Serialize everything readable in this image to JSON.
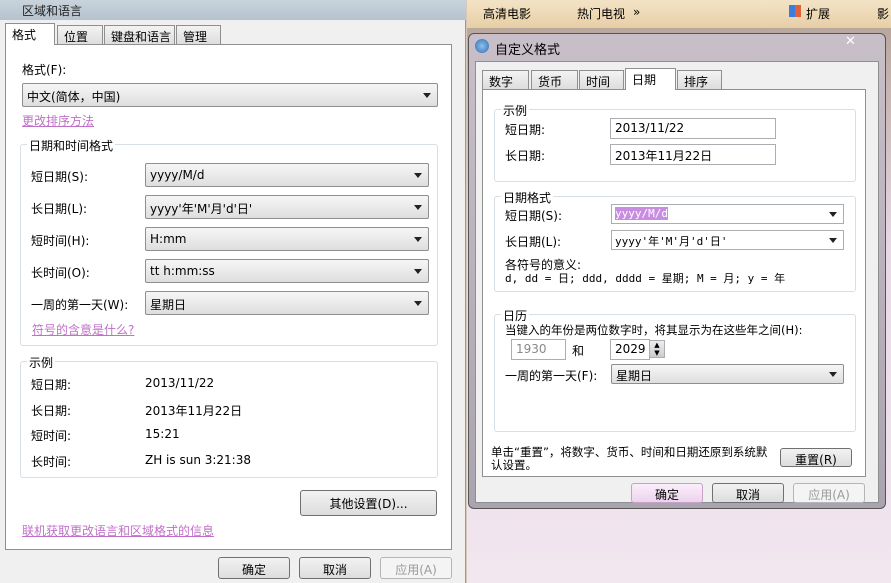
{
  "left_window": {
    "title": "区域和语言",
    "tabs": [
      "格式",
      "位置",
      "键盘和语言",
      "管理"
    ],
    "format_label": "格式(F):",
    "format_value": "中文(简体，中国)",
    "sort_link": "更改排序方法",
    "datetime_group": "日期和时间格式",
    "datetime_rows": [
      {
        "label": "短日期(S):",
        "value": "yyyy/M/d"
      },
      {
        "label": "长日期(L):",
        "value": "yyyy'年'M'月'd'日'"
      },
      {
        "label": "短时间(H):",
        "value": "H:mm"
      },
      {
        "label": "长时间(O):",
        "value": "tt h:mm:ss"
      },
      {
        "label": "一周的第一天(W):",
        "value": "星期日"
      }
    ],
    "symbols_link": "符号的含意是什么?",
    "example_group": "示例",
    "example_rows": [
      {
        "label": "短日期:",
        "value": "2013/11/22"
      },
      {
        "label": "长日期:",
        "value": "2013年11月22日"
      },
      {
        "label": "短时间:",
        "value": "15:21"
      },
      {
        "label": "长时间:",
        "value": "ZH is sun  3:21:38"
      }
    ],
    "other_settings": "其他设置(D)...",
    "online_link": "联机获取更改语言和区域格式的信息",
    "ok": "确定",
    "cancel": "取消",
    "apply": "应用(A)"
  },
  "browser_bar": {
    "items": [
      "高清电影",
      "热门电视",
      "»",
      "扩展",
      "影"
    ]
  },
  "dialog": {
    "title": "自定义格式",
    "close": "✕",
    "tabs": [
      "数字",
      "货币",
      "时间",
      "日期",
      "排序"
    ],
    "active_tab": "日期",
    "example_group": "示例",
    "example_short_label": "短日期:",
    "example_short_value": "2013/11/22",
    "example_long_label": "长日期:",
    "example_long_value": "2013年11月22日",
    "format_group": "日期格式",
    "short_label": "短日期(S):",
    "short_value": "yyyy/M/d",
    "long_label": "长日期(L):",
    "long_value": "yyyy'年'M'月'd'日'",
    "symbols_title": "各符号的意义:",
    "symbols_legend": "d, dd = 日;  ddd, dddd = 星期;  M = 月;  y = 年",
    "calendar_group": "日历",
    "calendar_text": "当键入的年份是两位数字时，将其显示为在这些年之间(H):",
    "year_from": "1930",
    "and": "和",
    "year_to": "2029",
    "first_day_label": "一周的第一天(F):",
    "first_day_value": "星期日",
    "reset_text": "单击“重置”，将数字、货币、时间和日期还原到系统默认设置。",
    "reset": "重置(R)",
    "ok": "确定",
    "cancel": "取消",
    "apply": "应用(A)"
  },
  "colors": {
    "link": "#c070c8",
    "selection": "#c88ce0"
  }
}
